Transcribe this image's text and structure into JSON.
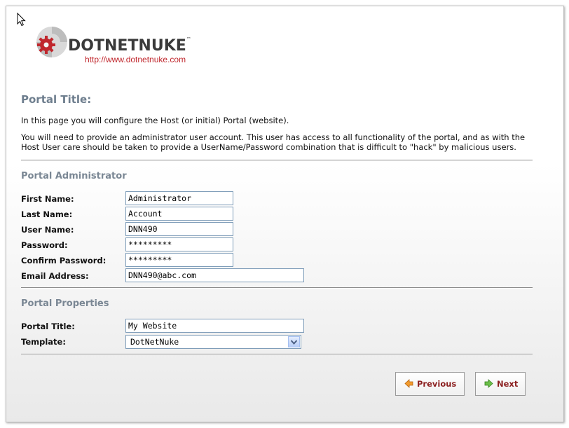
{
  "logo": {
    "name": "DOTNETNUKE",
    "trademark": "™",
    "url": "http://www.dotnetnuke.com"
  },
  "page": {
    "title": "Portal Title:",
    "intro": "In this page you will configure the Host (or initial) Portal (website).",
    "description": "You will need to provide an administrator user account. This user has access to all functionality of the portal, and as with the Host User care should be taken to provide a UserName/Password combination that is difficult to \"hack\" by malicious users."
  },
  "admin": {
    "heading": "Portal Administrator",
    "fields": [
      {
        "label": "First Name:",
        "value": "Administrator"
      },
      {
        "label": "Last Name:",
        "value": "Account"
      },
      {
        "label": "User Name:",
        "value": "DNN490"
      },
      {
        "label": "Password:",
        "value": "*********"
      },
      {
        "label": "Confirm Password:",
        "value": "*********"
      },
      {
        "label": "Email Address:",
        "value": "DNN490@abc.com"
      }
    ]
  },
  "properties": {
    "heading": "Portal Properties",
    "portal_title_label": "Portal Title:",
    "portal_title_value": "My Website",
    "template_label": "Template:",
    "template_value": "DotNetNuke"
  },
  "buttons": {
    "previous": "Previous",
    "next": "Next"
  },
  "colors": {
    "brand_red": "#c0272d",
    "heading_gray": "#6e7e8e",
    "button_text": "#8b1f1f"
  }
}
